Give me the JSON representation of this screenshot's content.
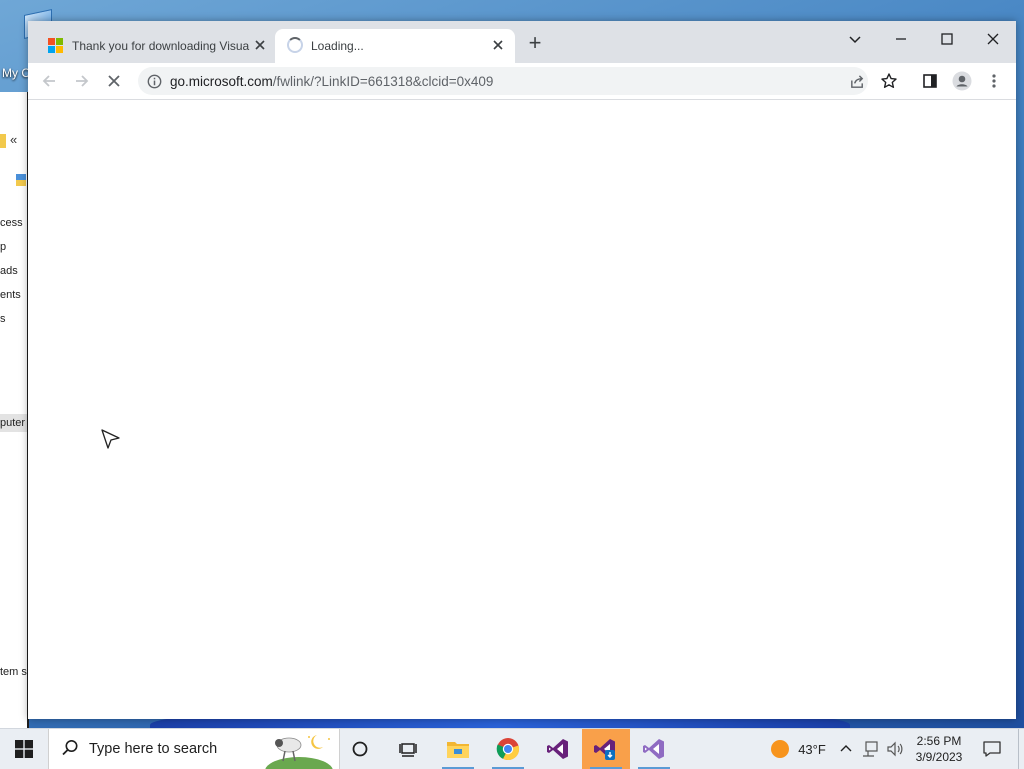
{
  "desktop": {
    "icon_label": "My C"
  },
  "explorer": {
    "collapse_glyph": "«",
    "nav_items": [
      "cess",
      "p",
      "ads",
      "ents",
      "s"
    ],
    "selected_item": "puter",
    "status_text": "tem s"
  },
  "browser": {
    "tabs": [
      {
        "title": "Thank you for downloading Visual Studio",
        "icon": "microsoft-logo",
        "active": false
      },
      {
        "title": "Loading...",
        "icon": "loading-spinner",
        "active": true
      }
    ],
    "new_tab_glyph": "+",
    "url_host": "go.microsoft.com",
    "url_path": "/fwlink/?LinkID=661318&clcid=0x409",
    "loading": true
  },
  "taskbar": {
    "search_placeholder": "Type here to search",
    "apps": [
      "file-explorer",
      "chrome",
      "visual-studio",
      "visual-studio-installer",
      "visual-studio-preview"
    ],
    "weather_temp": "43°F",
    "time": "2:56 PM",
    "date": "3/9/2023"
  },
  "colors": {
    "tab_strip": "#dee1e6",
    "omnibox": "#f1f3f4",
    "taskbar": "#eaeef3",
    "active_taskbar_app": "#f9a04a",
    "ms_red": "#f25022",
    "ms_green": "#7fba00",
    "ms_blue": "#00a4ef",
    "ms_yellow": "#ffb900"
  }
}
